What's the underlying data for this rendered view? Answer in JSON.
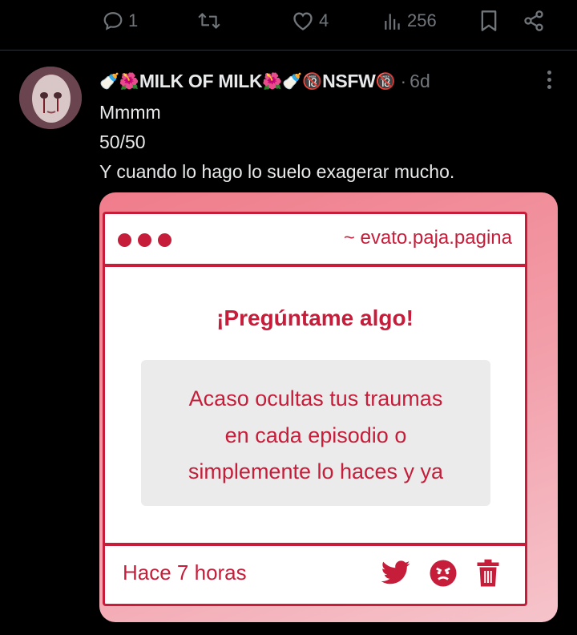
{
  "actions": {
    "reply_count": "1",
    "like_count": "4",
    "views_count": "256"
  },
  "tweet": {
    "display_name": "MILK OF MILK",
    "nsfw_tag": "NSFW",
    "separator": "·",
    "time": "6d",
    "lines": [
      "Mmmm",
      "50/50",
      "Y cuando lo hago lo suelo exagerar mucho."
    ]
  },
  "card": {
    "url": "~ evato.paja.pagina",
    "heading": "¡Pregúntame algo!",
    "question_lines": [
      "Acaso ocultas tus traumas",
      "en cada episodio o",
      "simplemente lo haces y ya"
    ],
    "time_ago": "Hace 7 horas"
  },
  "colors": {
    "accent": "#c61e3a",
    "muted": "#71767b",
    "background": "#000000"
  },
  "icons": [
    "reply-icon",
    "retweet-icon",
    "like-icon",
    "views-icon",
    "bookmark-icon",
    "share-icon",
    "more-icon",
    "twitter-bird-icon",
    "angry-face-icon",
    "trash-icon"
  ]
}
